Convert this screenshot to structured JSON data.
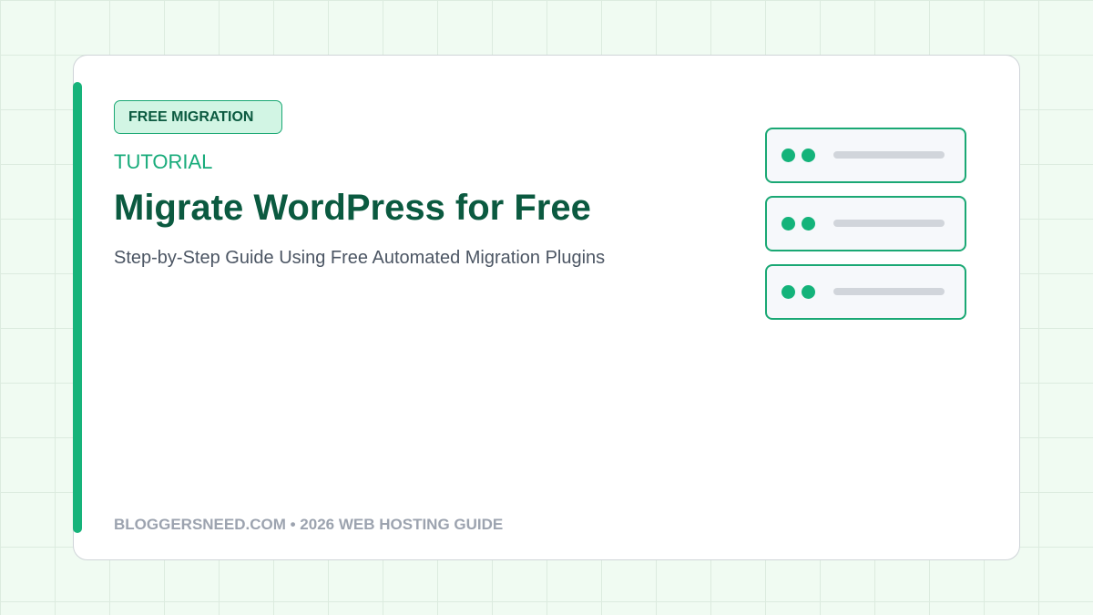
{
  "badge": {
    "label": "FREE MIGRATION"
  },
  "eyebrow": "TUTORIAL",
  "title": "Migrate WordPress for Free",
  "subtitle": "Step-by-Step Guide Using Free Automated Migration Plugins",
  "footer": "BLOGGERSNEED.COM • 2026 WEB HOSTING GUIDE",
  "illustration": {
    "servers": [
      {
        "icon": "server-icon"
      },
      {
        "icon": "server-icon"
      },
      {
        "icon": "server-icon"
      }
    ]
  },
  "colors": {
    "accent": "#16b37a",
    "title": "#0b5a40",
    "badge_bg": "#d2f5e4",
    "background": "#f0fbf2"
  }
}
